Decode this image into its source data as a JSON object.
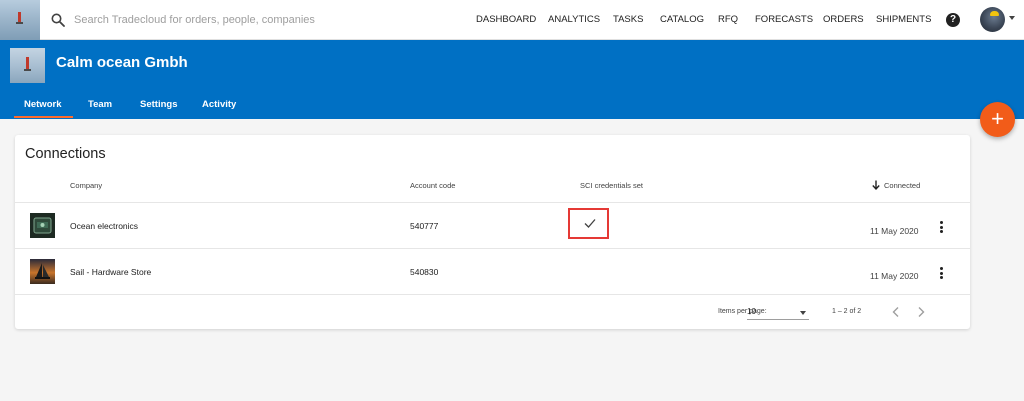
{
  "search": {
    "placeholder": "Search Tradecloud for orders, people, companies"
  },
  "nav": {
    "items": [
      {
        "label": "DASHBOARD"
      },
      {
        "label": "ANALYTICS"
      },
      {
        "label": "TASKS"
      },
      {
        "label": "CATALOG"
      },
      {
        "label": "RFQ"
      },
      {
        "label": "FORECASTS"
      },
      {
        "label": "ORDERS"
      },
      {
        "label": "SHIPMENTS"
      }
    ],
    "help_glyph": "?"
  },
  "header": {
    "company_name": "Calm ocean Gmbh",
    "tabs": [
      {
        "label": "Network",
        "active": true
      },
      {
        "label": "Team"
      },
      {
        "label": "Settings"
      },
      {
        "label": "Activity"
      }
    ]
  },
  "fab": {
    "glyph": "+"
  },
  "connections": {
    "title": "Connections",
    "columns": {
      "company": "Company",
      "account_code": "Account code",
      "sci": "SCI credentials set",
      "connected": "Connected"
    },
    "rows": [
      {
        "company": "Ocean electronics",
        "account_code": "540777",
        "sci_set": true,
        "connected": "11 May 2020"
      },
      {
        "company": "Sail - Hardware Store",
        "account_code": "540830",
        "sci_set": false,
        "connected": "11 May 2020"
      }
    ],
    "paginator": {
      "items_per_page_label": "Items per page:",
      "items_per_page_value": "10",
      "range": "1 – 2 of 2"
    }
  },
  "colors": {
    "brand_blue": "#0070c4",
    "accent_orange": "#f25c19",
    "highlight_red": "#e53935"
  }
}
